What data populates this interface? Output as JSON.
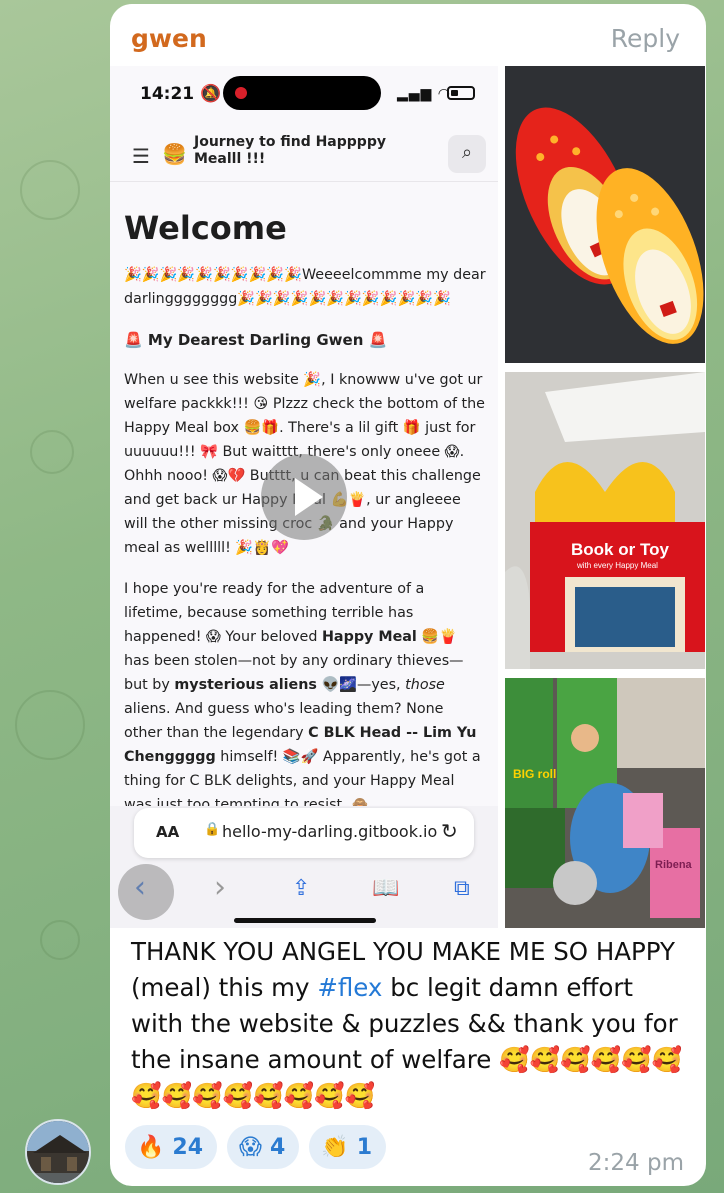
{
  "message": {
    "sender": "gwen",
    "reply_label": "Reply",
    "time": "2:24 pm",
    "caption_parts": [
      "THANK YOU ANGEL YOU MAKE ME SO HAPPY (meal) this my ",
      "#flex",
      " bc legit damn effort with the website & puzzles && thank you for the insane amount of welfare 🥰🥰🥰🥰🥰🥰🥰🥰🥰🥰🥰🥰🥰🥰"
    ],
    "reactions": [
      {
        "emoji": "🔥",
        "count": "24"
      },
      {
        "emoji": "😱",
        "count": "4"
      },
      {
        "emoji": "👏",
        "count": "1"
      }
    ]
  },
  "screenshot": {
    "status_time": "14:21 🔕",
    "site_logo": "🍔",
    "site_title": "Journey to find Happppy Mealll !!!",
    "welcome": "Welcome",
    "intro": "🎉🎉🎉🎉🎉🎉🎉🎉🎉🎉Weeeelcommme my dear darlingggggggg🎉🎉🎉🎉🎉🎉🎉🎉🎉🎉🎉🎉",
    "section_heading": "🚨 My Dearest Darling Gwen 🚨",
    "para1": "When u see this website 🎉, I knowww u've got ur welfare packkk!!! 😘 Plzzz check the bottom of the Happy Meal box 🍔🎁. There's a lil gift 🎁 just for uuuuuu!!! 🎀 But waitttt, there's only oneee 😱. Ohhh nooo! 😱💔 Butttt, u can beat this challenge and get back ur Happy Meal 💪🍟, ur angleeee will the other missing croc 🐊 and your Happy meal as welllll! 🎉👸💖",
    "para2_parts": [
      "I hope you're ready for the adventure of a lifetime, because something terrible has happened! 😱 Your beloved ",
      "Happy Meal",
      " 🍔🍟 has been stolen—not by any ordinary thieves—but by ",
      "mysterious aliens",
      " 👽🌌—yes, ",
      "those",
      " aliens. And guess who's leading them? None other than the legendary ",
      "C BLK Head -- Lim Yu Chenggggg",
      " himself! 📚🚀 Apparently, he's got a thing for C BLK delights, and your Happy Meal was just too tempting to resist. 🙈"
    ],
    "url_aa": "AA",
    "url": "hello-my-darling.gitbook.io"
  },
  "photos": [
    {
      "description": "red and yellow croc shoes"
    },
    {
      "description": "Happy Meal box Book or Toy"
    },
    {
      "description": "snacks and drinks"
    }
  ],
  "photo_texts": {
    "book_or_toy": "Book or Toy",
    "with_every": "with every Happy Meal",
    "big_roll": "BIG roll",
    "ribena": "Ribena"
  },
  "icons": {
    "hamburger": "☰",
    "search": "⌕",
    "lock": "🔒",
    "reload": "↻",
    "back": "‹",
    "forward": "›",
    "share": "⇪",
    "bookmarks": "📖",
    "tabs": "⧉"
  }
}
